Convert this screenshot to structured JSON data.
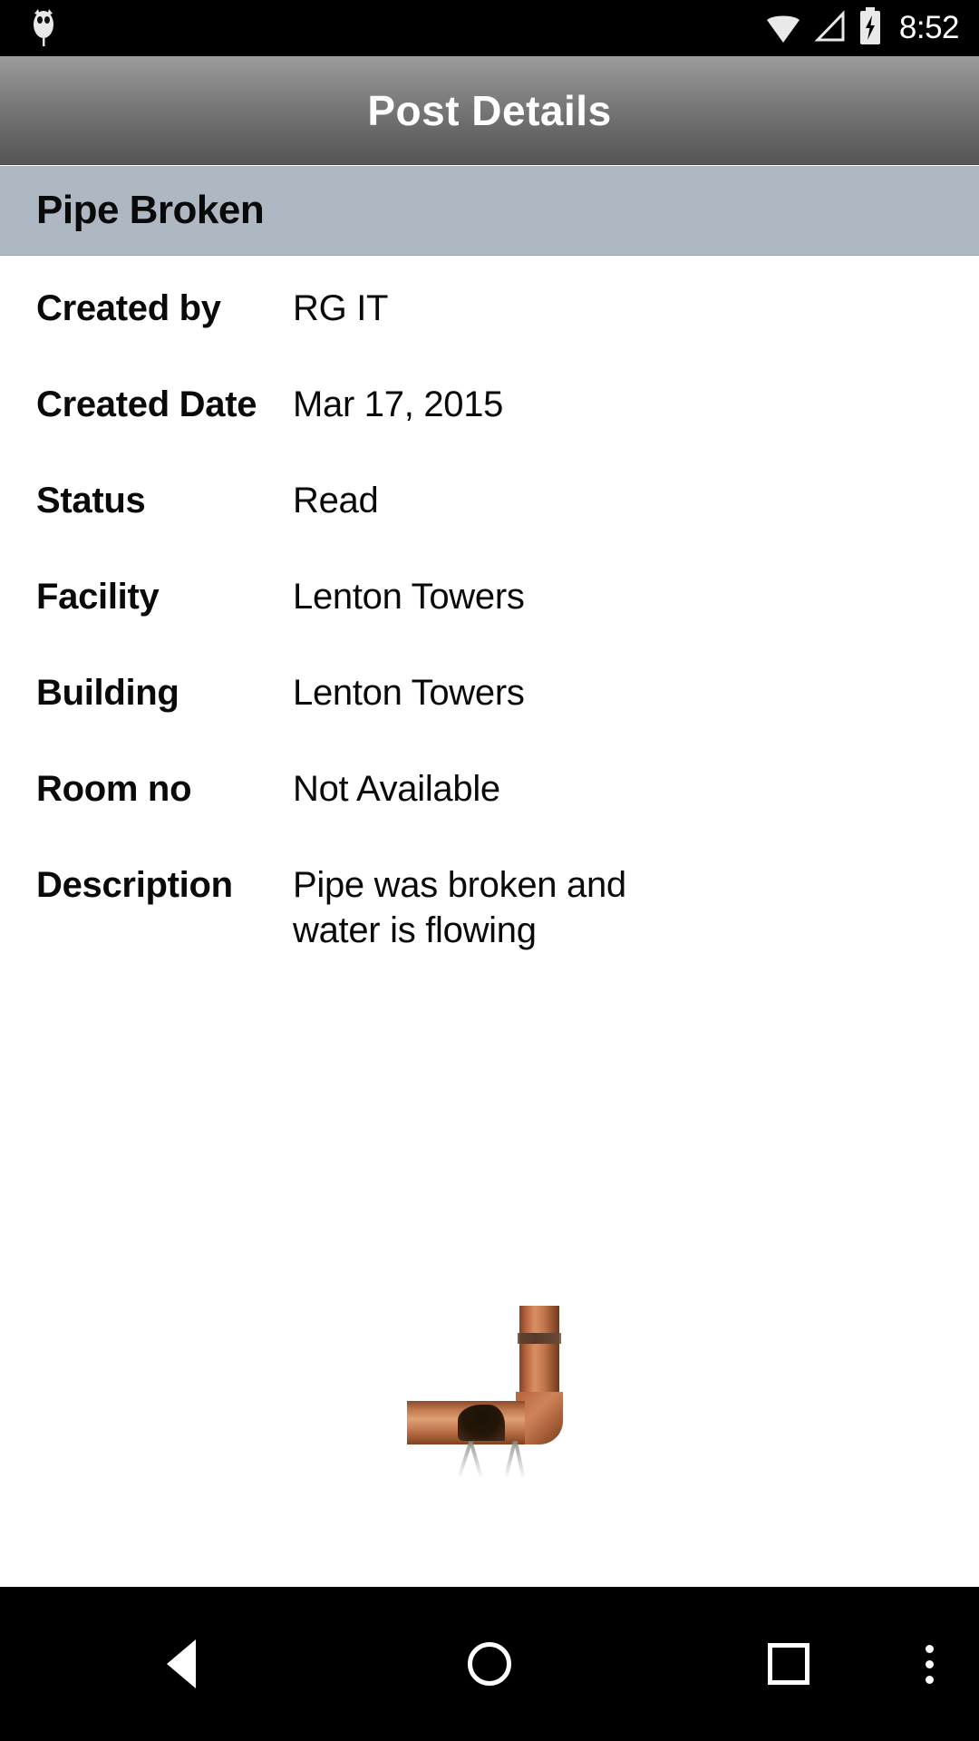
{
  "status_bar": {
    "time": "8:52",
    "icons": [
      {
        "name": "notification-owl-icon"
      },
      {
        "name": "wifi-icon"
      },
      {
        "name": "cellular-signal-icon"
      },
      {
        "name": "battery-charging-icon"
      }
    ]
  },
  "action_bar": {
    "title": "Post Details"
  },
  "post": {
    "title": "Pipe Broken",
    "title_bar_color": "#aeb8c2",
    "details": [
      {
        "label": "Created by",
        "value": "RG IT"
      },
      {
        "label": "Created Date",
        "value": "Mar 17, 2015"
      },
      {
        "label": "Status",
        "value": "Read"
      },
      {
        "label": "Facility",
        "value": "Lenton Towers"
      },
      {
        "label": "Building",
        "value": "Lenton Towers"
      },
      {
        "label": "Room no",
        "value": "Not Available"
      },
      {
        "label": "Description",
        "value": "Pipe was broken and water is flowing"
      }
    ],
    "attachment": {
      "name": "broken-copper-pipe-photo",
      "alt": "Broken copper pipe with water spraying from a burst elbow joint"
    }
  },
  "navigation_bar": {
    "buttons": [
      {
        "name": "back-button",
        "icon": "back-triangle-icon"
      },
      {
        "name": "home-button",
        "icon": "home-circle-icon"
      },
      {
        "name": "recents-button",
        "icon": "recents-square-icon"
      },
      {
        "name": "overflow-button",
        "icon": "overflow-dots-icon"
      }
    ]
  }
}
